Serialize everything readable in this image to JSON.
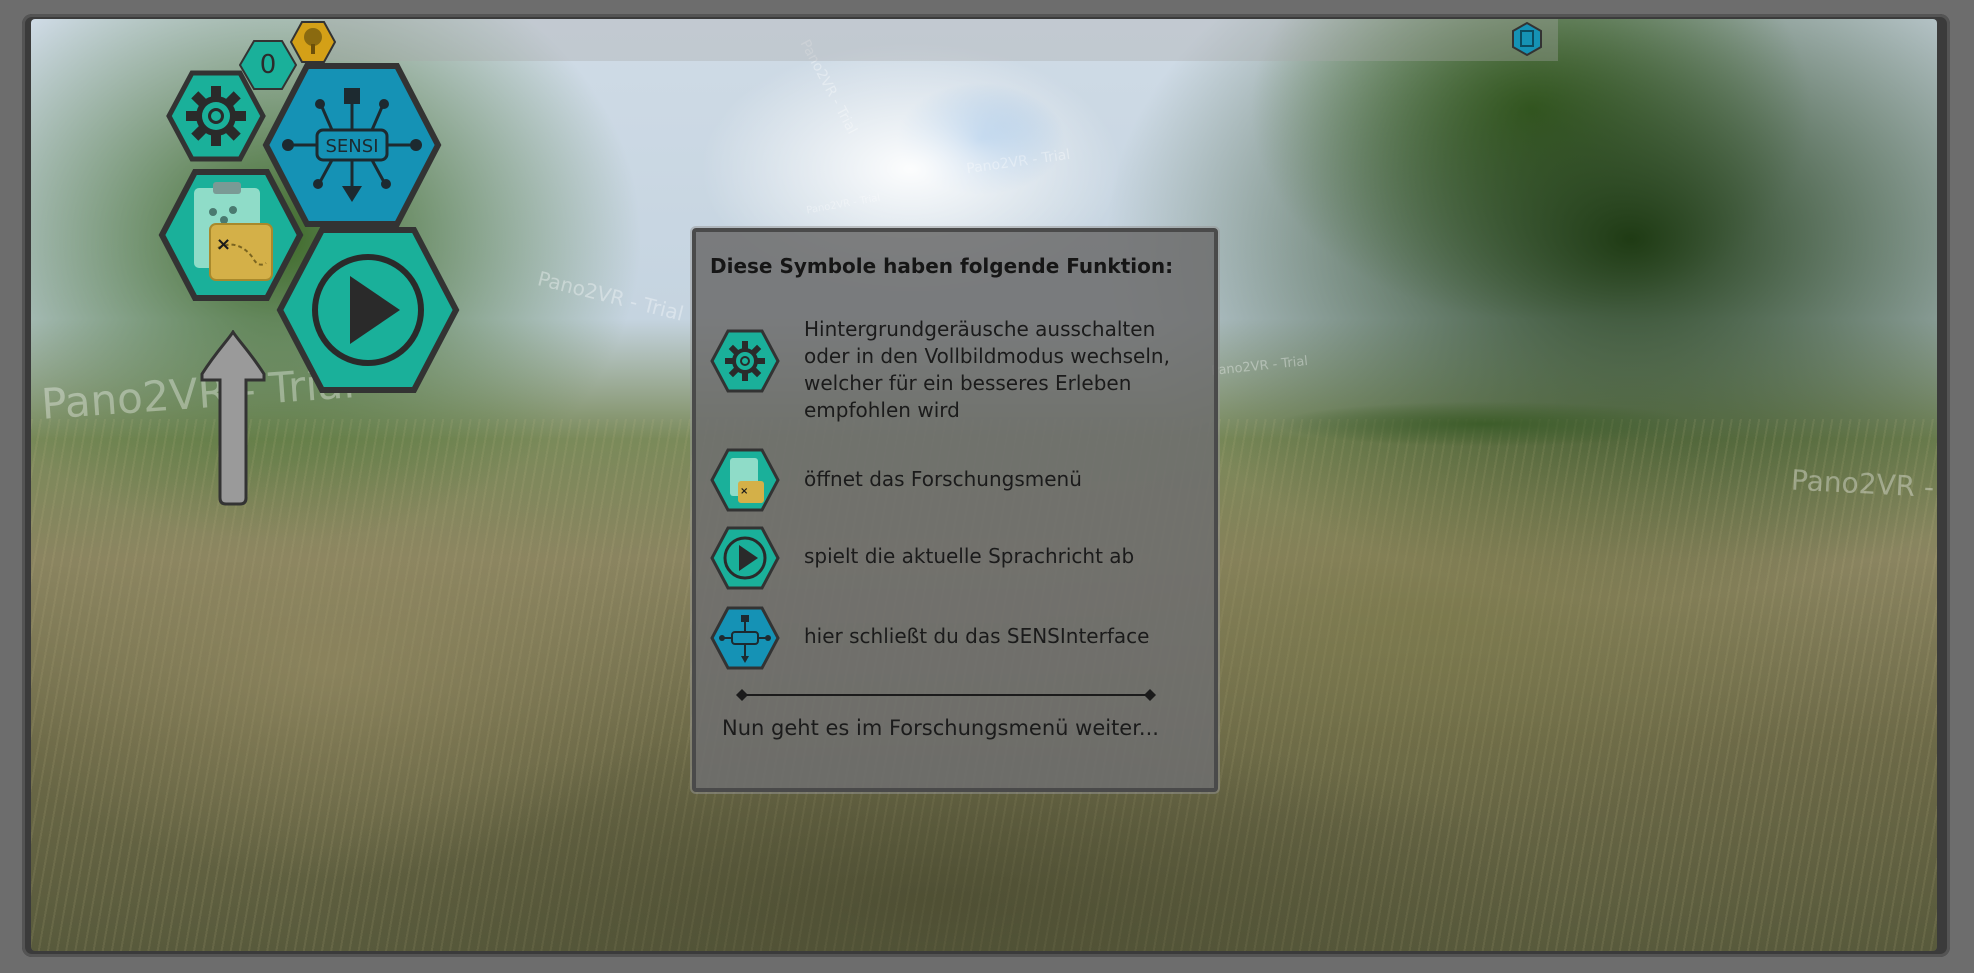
{
  "watermark": {
    "text": "Pano2VR - Trial"
  },
  "toolbar": {
    "counter": "0",
    "info_icon": "document-icon",
    "tree_icon": "tree-icon"
  },
  "menu": {
    "buttons": [
      {
        "name": "settings",
        "icon": "gear-icon",
        "color": "#1ab09a"
      },
      {
        "name": "sensi",
        "icon": "circuit-icon",
        "label": "SENSI",
        "color": "#1592b5"
      },
      {
        "name": "research",
        "icon": "clipboard-map-icon",
        "color": "#1ab09a"
      },
      {
        "name": "play",
        "icon": "play-icon",
        "color": "#1ab09a"
      }
    ],
    "navigation": {
      "icon": "arrow-up-icon"
    }
  },
  "dialog": {
    "title": "Diese Symbole haben folgende Funktion:",
    "items": [
      {
        "icon": "gear-icon",
        "text": "Hintergrundgeräusche ausschalten oder in den Vollbildmodus wechseln, welcher für ein besseres Erleben empfohlen wird"
      },
      {
        "icon": "clipboard-map-icon",
        "text": "öffnet das Forschungsmenü"
      },
      {
        "icon": "play-icon",
        "text": "spielt die aktuelle Sprachricht ab"
      },
      {
        "icon": "circuit-icon",
        "text": "hier schließt du das SENSInterface"
      }
    ],
    "footer": "Nun geht es im Forschungsmenü weiter..."
  },
  "colors": {
    "teal": "#1ab09a",
    "blue": "#1592b5",
    "gold": "#d4a017",
    "dialog_bg": "#6e6e6e"
  }
}
